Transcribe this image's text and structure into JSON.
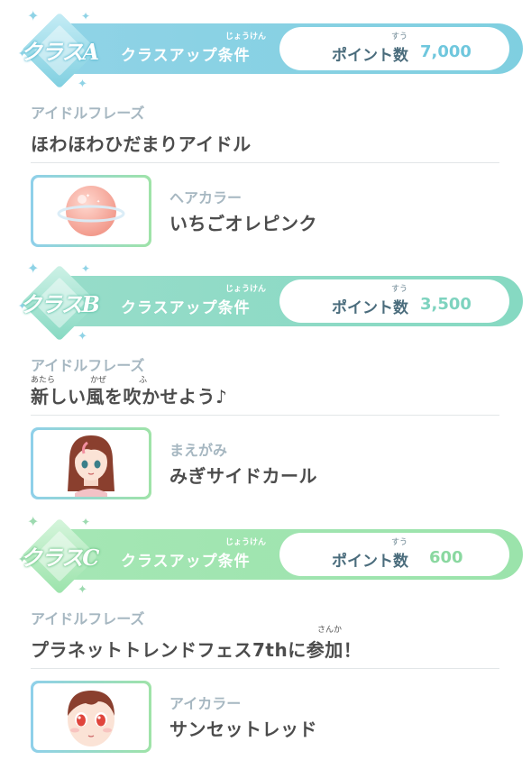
{
  "common": {
    "condition_label": "クラスアップ条件",
    "condition_ruby": "じょうけん",
    "points_label": "ポイント数",
    "points_ruby": "すう"
  },
  "sections": [
    {
      "class_label": "クラスA",
      "points_value": "7,000",
      "accent_color": "#7fcfe0",
      "phrase_label": "アイドルフレーズ",
      "phrase_text": "ほわほわひだまりアイドル",
      "item_label": "ヘアカラー",
      "item_name": "いちごオレピンク",
      "item_icon": "pink-planet-icon"
    },
    {
      "class_label": "クラスB",
      "points_value": "3,500",
      "accent_color": "#8ddcc5",
      "phrase_label": "アイドルフレーズ",
      "phrase_text": "新しい風を吹かせよう♪",
      "phrase_ruby": [
        "あたら",
        "かぜ",
        "ふ"
      ],
      "item_label": "まえがみ",
      "item_name": "みぎサイドカール",
      "item_icon": "girl-side-curl-bangs-icon"
    },
    {
      "class_label": "クラスC",
      "points_value": "600",
      "accent_color": "#9be3ab",
      "phrase_label": "アイドルフレーズ",
      "phrase_text": "プラネットトレンドフェス7thに参加！",
      "phrase_ruby": [
        "さんか"
      ],
      "item_label": "アイカラー",
      "item_name": "サンセットレッド",
      "item_icon": "girl-sunset-red-eyes-icon"
    }
  ]
}
